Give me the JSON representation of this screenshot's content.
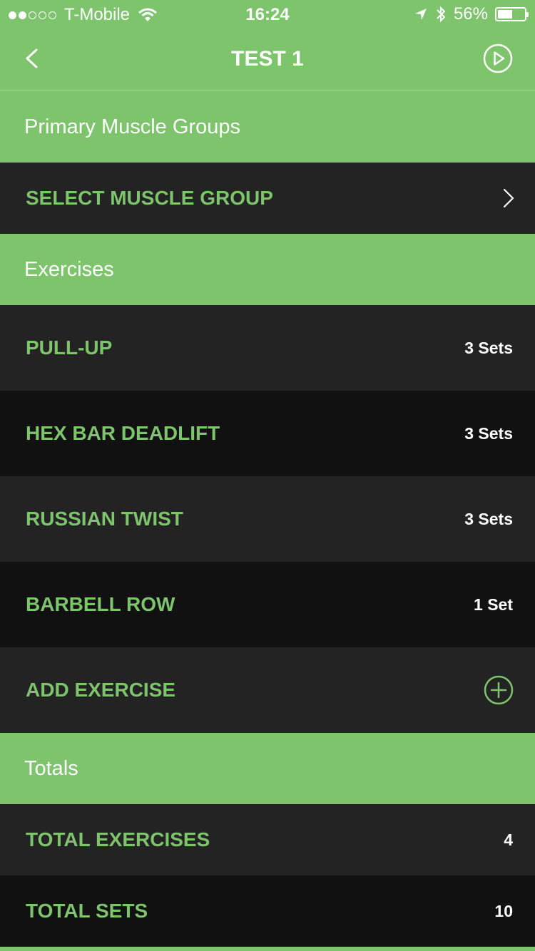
{
  "status_bar": {
    "carrier": "T-Mobile",
    "time": "16:24",
    "battery_percent": "56%",
    "battery_level": 0.56
  },
  "nav": {
    "title": "TEST 1",
    "back_icon": "chevron-left-icon",
    "play_icon": "play-circle-icon"
  },
  "sections": {
    "muscle_groups": "Primary Muscle Groups",
    "exercises": "Exercises",
    "totals": "Totals"
  },
  "select_muscle_group": {
    "label": "SELECT MUSCLE GROUP",
    "icon": "chevron-right-icon"
  },
  "exercises": [
    {
      "name": "PULL-UP",
      "sets": "3 Sets"
    },
    {
      "name": "HEX BAR DEADLIFT",
      "sets": "3 Sets"
    },
    {
      "name": "RUSSIAN TWIST",
      "sets": "3 Sets"
    },
    {
      "name": "BARBELL ROW",
      "sets": "1 Set"
    }
  ],
  "add_exercise": {
    "label": "ADD EXERCISE",
    "icon": "plus-circle-icon"
  },
  "totals": {
    "total_exercises_label": "TOTAL EXERCISES",
    "total_exercises_value": "4",
    "total_sets_label": "TOTAL SETS",
    "total_sets_value": "10"
  },
  "colors": {
    "accent": "#7dc46d",
    "row_dark": "#232323",
    "row_darker": "#111111",
    "text_white": "#ffffff"
  }
}
